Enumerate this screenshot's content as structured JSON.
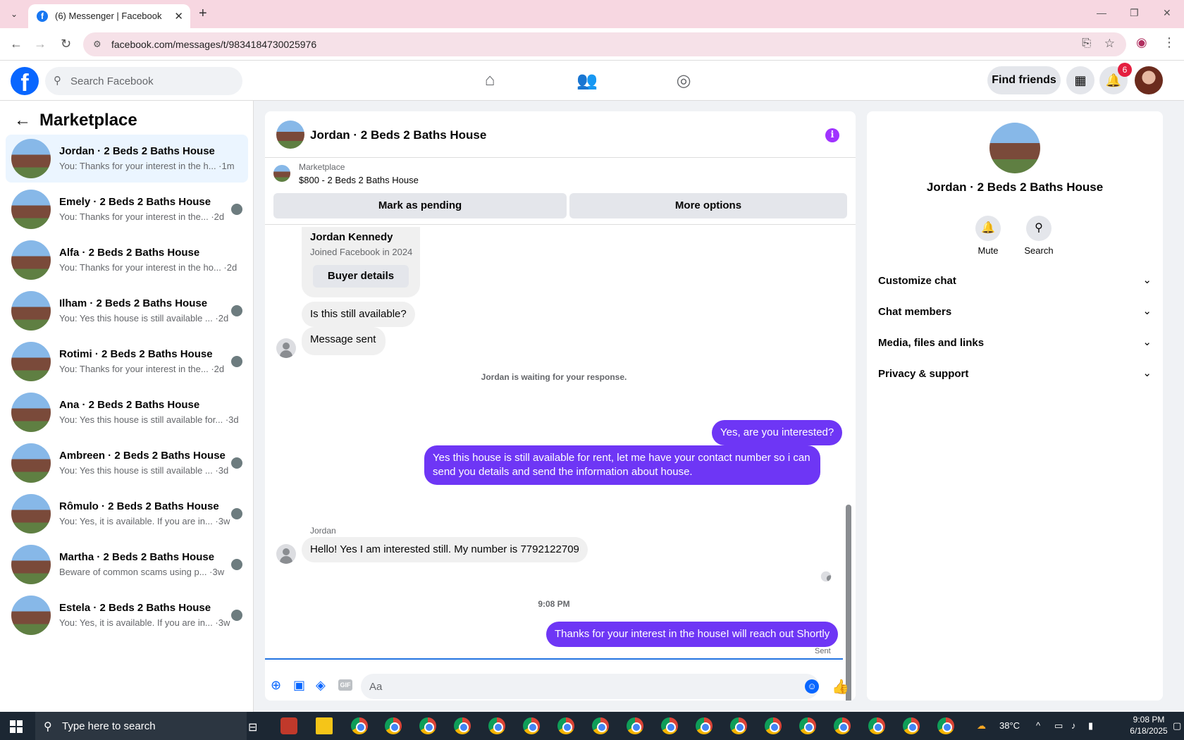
{
  "browser": {
    "tab_title": "(6) Messenger | Facebook",
    "url": "facebook.com/messages/t/9834184730025976"
  },
  "header": {
    "search_placeholder": "Search Facebook",
    "find_friends": "Find friends",
    "notif_count": "6"
  },
  "sidebar": {
    "title": "Marketplace",
    "conversations": [
      {
        "name": "Jordan · 2 Beds 2 Baths House",
        "preview": "You: Thanks for your interest in the h... ·1m",
        "active": true
      },
      {
        "name": "Emely · 2 Beds 2 Baths House",
        "preview": "You: Thanks for your interest in the... ·2d"
      },
      {
        "name": "Alfa · 2 Beds 2 Baths House",
        "preview": "You: Thanks for your interest in the ho... ·2d"
      },
      {
        "name": "Ilham · 2 Beds 2 Baths House",
        "preview": "You: Yes this house is still available ... ·2d"
      },
      {
        "name": "Rotimi · 2 Beds 2 Baths House",
        "preview": "You: Thanks for your interest in the... ·2d"
      },
      {
        "name": "Ana · 2 Beds 2 Baths House",
        "preview": "You: Yes this house is still available for... ·3d"
      },
      {
        "name": "Ambreen · 2 Beds 2 Baths House",
        "preview": "You: Yes this house is still available ... ·3d"
      },
      {
        "name": "Rômulo · 2 Beds 2 Baths House",
        "preview": "You: Yes, it is available. If you are in... ·3w"
      },
      {
        "name": "Martha · 2 Beds 2 Baths House",
        "preview": "Beware of common scams using p... ·3w"
      },
      {
        "name": "Estela · 2 Beds 2 Baths House",
        "preview": "You: Yes, it is available. If you are in... ·3w"
      }
    ]
  },
  "chat": {
    "title": "Jordan · 2 Beds 2 Baths House",
    "listing_source": "Marketplace",
    "listing_line": "$800 - 2 Beds 2 Baths House",
    "mark_pending": "Mark as pending",
    "more_options": "More options",
    "buyer_name": "Jordan Kennedy",
    "buyer_joined": "Joined Facebook in 2024",
    "buyer_details": "Buyer details",
    "msg1": "Is this still available?",
    "msg2": "Message sent",
    "waiting": "Jordan is waiting for your response.",
    "out1": "Yes, are you interested?",
    "out2": "Yes this house is still available for rent, let me have your contact number so i can send you details and send the information about house.",
    "sender_label": "Jordan",
    "in3": "Hello! Yes I am interested still. My number is 7792122709",
    "time": "9:08 PM",
    "out3": "Thanks for your interest in the houseI will reach out Shortly",
    "sent": "Sent",
    "composer_placeholder": "Aa",
    "gif": "GIF"
  },
  "details": {
    "name": "Jordan · 2 Beds 2 Baths House",
    "mute": "Mute",
    "search": "Search",
    "sections": [
      "Customize chat",
      "Chat members",
      "Media, files and links",
      "Privacy & support"
    ]
  },
  "taskbar": {
    "search_placeholder": "Type here to search",
    "weather": "38°C",
    "time": "9:08 PM",
    "date": "6/18/2025"
  }
}
